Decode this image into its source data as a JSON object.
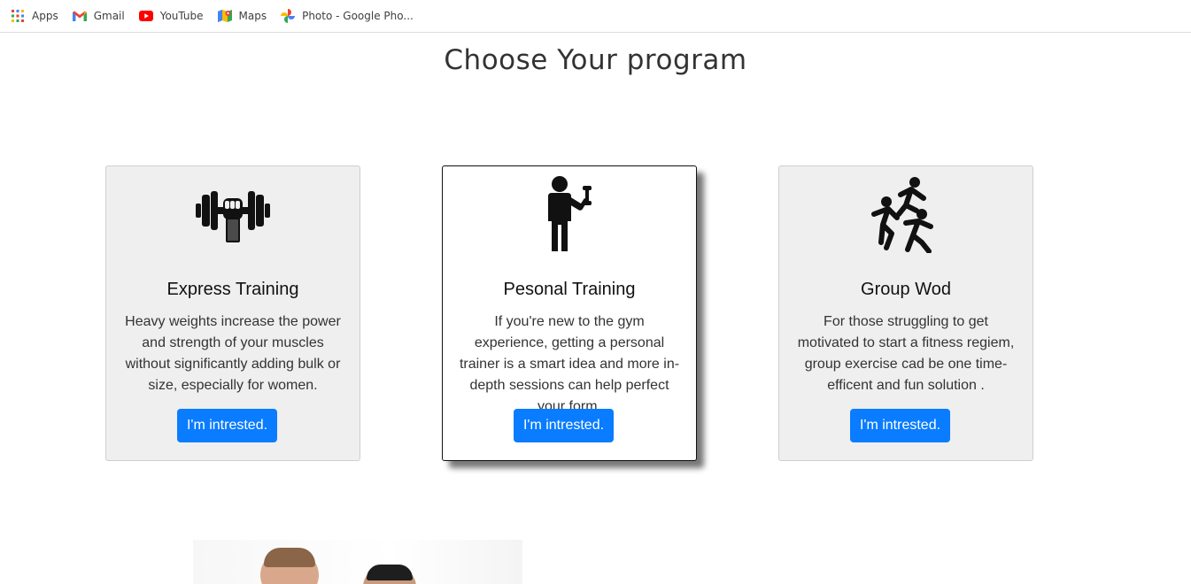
{
  "bookmarks": [
    {
      "label": "Apps",
      "icon": "apps-grid-icon"
    },
    {
      "label": "Gmail",
      "icon": "gmail-icon"
    },
    {
      "label": "YouTube",
      "icon": "youtube-icon"
    },
    {
      "label": "Maps",
      "icon": "maps-icon"
    },
    {
      "label": "Photo - Google Pho...",
      "icon": "google-photos-icon"
    }
  ],
  "heading": "Choose Your program",
  "cards": [
    {
      "icon": "dumbbell-fist-icon",
      "title": "Express Training",
      "description": "Heavy weights increase the power and strength of your muscles without significantly adding bulk or size, especially for women.",
      "button": "I'm intrested."
    },
    {
      "icon": "personal-trainer-icon",
      "title": "Pesonal Training",
      "description": "If you're new to the gym experience, getting a personal trainer is a smart idea and more in-depth sessions can help perfect your form.",
      "button": "I'm intrested."
    },
    {
      "icon": "group-running-icon",
      "title": "Group Wod",
      "description": "For those struggling to get motivated to start a fitness regiem, group exercise cad be one time-efficent and fun solution .",
      "button": "I'm intrested."
    }
  ],
  "colors": {
    "button": "#0a7cff",
    "card_bg": "#efefef",
    "card_active_bg": "#ffffff"
  }
}
